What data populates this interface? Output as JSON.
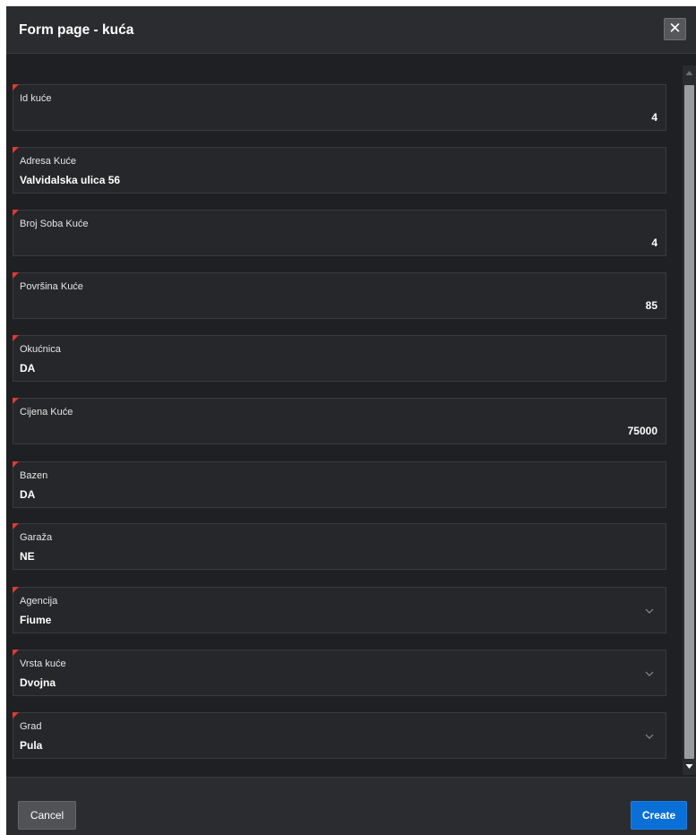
{
  "dialog": {
    "title": "Form page - kuća",
    "close_symbol": "✕"
  },
  "fields": [
    {
      "label": "Id kuće",
      "value": "4",
      "align": "right",
      "type": "number"
    },
    {
      "label": "Adresa Kuće",
      "value": "Valvidalska ulica 56",
      "align": "left",
      "type": "text"
    },
    {
      "label": "Broj Soba Kuće",
      "value": "4",
      "align": "right",
      "type": "number"
    },
    {
      "label": "Površina Kuće",
      "value": "85",
      "align": "right",
      "type": "number"
    },
    {
      "label": "Okućnica",
      "value": "DA",
      "align": "left",
      "type": "text"
    },
    {
      "label": "Cijena Kuće",
      "value": "75000",
      "align": "right",
      "type": "number"
    },
    {
      "label": "Bazen",
      "value": "DA",
      "align": "left",
      "type": "text"
    },
    {
      "label": "Garaža",
      "value": "NE",
      "align": "left",
      "type": "text"
    },
    {
      "label": "Agencija",
      "value": "Fiume",
      "align": "left",
      "type": "select"
    },
    {
      "label": "Vrsta kuće",
      "value": "Dvojna",
      "align": "left",
      "type": "select"
    },
    {
      "label": "Grad",
      "value": "Pula",
      "align": "left",
      "type": "select"
    }
  ],
  "footer": {
    "cancel_label": "Cancel",
    "create_label": "Create"
  },
  "colors": {
    "required_marker": "#e03b2f",
    "primary_button": "#0a6fd6"
  },
  "icons": {
    "close": "close-icon",
    "select": "chevron-down-icon",
    "scroll_up": "scroll-up-arrow-icon",
    "scroll_down": "scroll-down-arrow-icon"
  }
}
